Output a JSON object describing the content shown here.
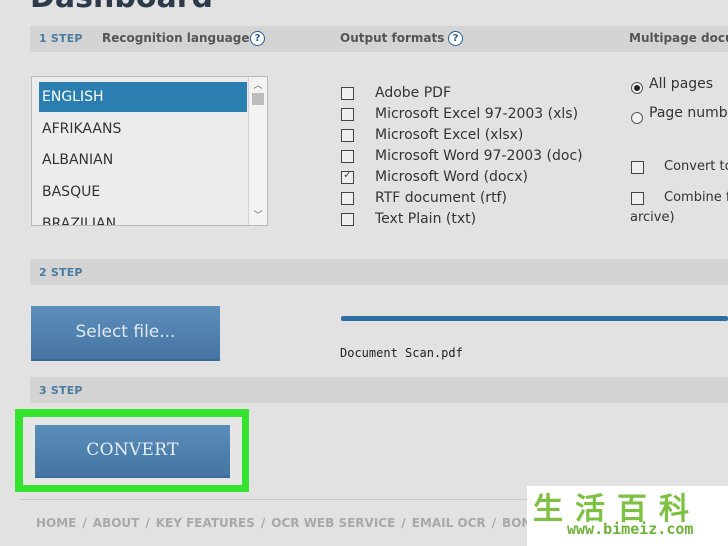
{
  "header": {
    "title": "Dashboard"
  },
  "step1": {
    "number": "1 STEP",
    "recognition_label": "Recognition language",
    "output_label": "Output formats",
    "multipage_label": "Multipage docu",
    "help_glyph": "?"
  },
  "languages": {
    "items": [
      "ENGLISH",
      "AFRIKAANS",
      "ALBANIAN",
      "BASQUE",
      "BRAZILIAN"
    ],
    "selected": "ENGLISH"
  },
  "formats": [
    {
      "label": "Adobe PDF",
      "checked": false
    },
    {
      "label": "Microsoft Excel 97-2003 (xls)",
      "checked": false
    },
    {
      "label": "Microsoft Excel (xlsx)",
      "checked": false
    },
    {
      "label": "Microsoft Word 97-2003 (doc)",
      "checked": false
    },
    {
      "label": "Microsoft Word (docx)",
      "checked": true
    },
    {
      "label": "RTF document (rtf)",
      "checked": false
    },
    {
      "label": "Text Plain (txt)",
      "checked": false
    }
  ],
  "multipage": {
    "all_pages": "All pages",
    "page_numbers": "Page numb",
    "convert_to": "Convert to",
    "combine": "Combine f",
    "archive": "arcive)"
  },
  "step2": {
    "number": "2 STEP",
    "select_file": "Select file...",
    "file_name": "Document Scan.pdf",
    "progress": 1.0
  },
  "step3": {
    "number": "3 STEP",
    "convert": "CONVERT"
  },
  "footer": {
    "links": [
      "HOME",
      "ABOUT",
      "KEY FEATURES",
      "OCR WEB SERVICE",
      "EMAIL OCR",
      "BONI"
    ],
    "separator": "/"
  },
  "watermark": {
    "chars": "生活百科",
    "url": "www.bimeiz.com"
  },
  "colors": {
    "accent": "#4a7ba0",
    "button": "#5a8ebb",
    "selected_item": "#2b7fb0",
    "highlight": "#33e32d",
    "watermark": "#7cc142"
  }
}
